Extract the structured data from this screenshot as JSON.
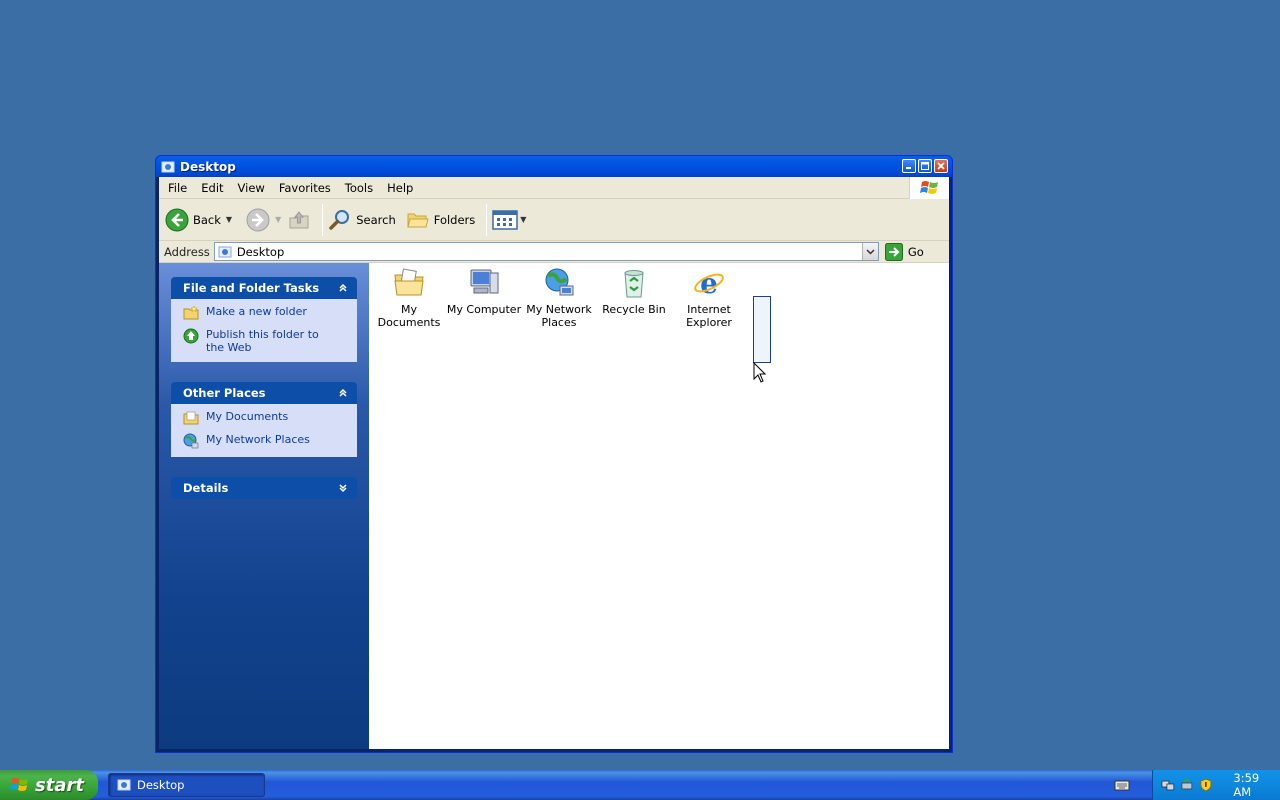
{
  "window": {
    "title": "Desktop",
    "menu": [
      "File",
      "Edit",
      "View",
      "Favorites",
      "Tools",
      "Help"
    ],
    "toolbar": {
      "back_label": "Back",
      "search_label": "Search",
      "folders_label": "Folders"
    },
    "address": {
      "label": "Address",
      "value": "Desktop",
      "go_label": "Go"
    }
  },
  "left_pane": {
    "file_tasks": {
      "title": "File and Folder Tasks",
      "items": [
        "Make a new folder",
        "Publish this folder to the Web"
      ]
    },
    "other_places": {
      "title": "Other Places",
      "items": [
        "My Documents",
        "My Network Places"
      ]
    },
    "details": {
      "title": "Details"
    }
  },
  "content": {
    "icons": [
      {
        "label": "My Documents",
        "icon": "my-documents-icon"
      },
      {
        "label": "My Computer",
        "icon": "my-computer-icon"
      },
      {
        "label": "My Network Places",
        "icon": "my-network-places-icon"
      },
      {
        "label": "Recycle Bin",
        "icon": "recycle-bin-icon"
      },
      {
        "label": "Internet Explorer",
        "icon": "internet-explorer-icon"
      }
    ]
  },
  "taskbar": {
    "start_label": "start",
    "task_label": "Desktop",
    "clock": "3:59 AM"
  },
  "colors": {
    "desktop_bg": "#3a6ea5",
    "taskbar_blue": "#245edb",
    "start_green": "#36a436",
    "link_blue": "#0c3a9c"
  }
}
